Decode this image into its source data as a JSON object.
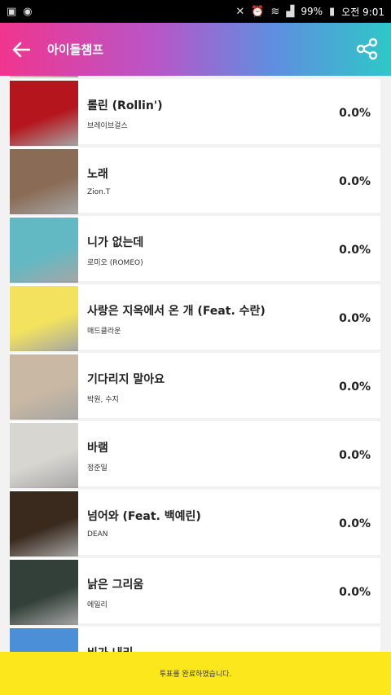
{
  "status_bar": {
    "left_icons": [
      "app-icon",
      "camera-icon"
    ],
    "battery": "99%",
    "time": "오전 9:01"
  },
  "app_bar": {
    "title": "아이돌챔프",
    "back_icon": "back-arrow-icon",
    "share_icon": "share-icon",
    "colors": [
      "#f0358f",
      "#5f8ee0",
      "#2ec8c8"
    ]
  },
  "songs": [
    {
      "title": "",
      "artist": "",
      "percent": "",
      "cover_bg": "#f4ded6"
    },
    {
      "title": "롤린 (Rollin')",
      "artist": "브레이브걸스",
      "percent": "0.0%",
      "cover_bg": "#b5151d"
    },
    {
      "title": "노래",
      "artist": "Zion.T",
      "percent": "0.0%",
      "cover_bg": "#8a6b55"
    },
    {
      "title": "니가 없는데",
      "artist": "로미오 (ROMEO)",
      "percent": "0.0%",
      "cover_bg": "#62b9c4"
    },
    {
      "title": "사랑은 지옥에서 온 개 (Feat. 수란)",
      "artist": "매드클라운",
      "percent": "0.0%",
      "cover_bg": "#f2e25e"
    },
    {
      "title": "기다리지 말아요",
      "artist": "박원, 수지",
      "percent": "0.0%",
      "cover_bg": "#c9b8a3"
    },
    {
      "title": "바램",
      "artist": "정준일",
      "percent": "0.0%",
      "cover_bg": "#d8d6d0"
    },
    {
      "title": "넘어와 (Feat. 백예린)",
      "artist": "DEAN",
      "percent": "0.0%",
      "cover_bg": "#3a2a1e"
    },
    {
      "title": "낡은 그리움",
      "artist": "에일리",
      "percent": "0.0%",
      "cover_bg": "#33403a"
    },
    {
      "title": "비가 내리",
      "artist": "",
      "percent": "",
      "cover_bg": "#4b8fd8"
    }
  ],
  "banner": {
    "text": "투표를 완료하였습니다.",
    "color": "#fbe71c"
  }
}
